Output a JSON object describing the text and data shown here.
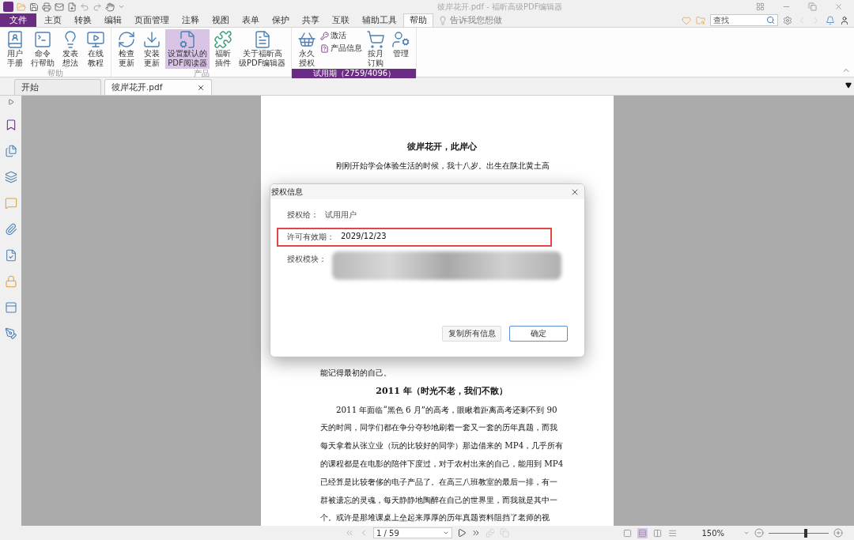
{
  "window": {
    "title": "彼岸花开.pdf - 福昕高级PDF编辑器"
  },
  "menu_tabs": [
    {
      "label": "文件",
      "kind": "file",
      "selected": false
    },
    {
      "label": "主页",
      "kind": "tab",
      "selected": false
    },
    {
      "label": "转换",
      "kind": "tab",
      "selected": false
    },
    {
      "label": "编辑",
      "kind": "tab",
      "selected": false
    },
    {
      "label": "页面管理",
      "kind": "tab",
      "selected": false
    },
    {
      "label": "注释",
      "kind": "tab",
      "selected": false
    },
    {
      "label": "视图",
      "kind": "tab",
      "selected": false
    },
    {
      "label": "表单",
      "kind": "tab",
      "selected": false
    },
    {
      "label": "保护",
      "kind": "tab",
      "selected": false
    },
    {
      "label": "共享",
      "kind": "tab",
      "selected": false
    },
    {
      "label": "互联",
      "kind": "tab",
      "selected": false
    },
    {
      "label": "辅助工具",
      "kind": "tab",
      "selected": false
    },
    {
      "label": "帮助",
      "kind": "tab",
      "selected": true
    }
  ],
  "tell_me": {
    "placeholder": "告诉我您想做"
  },
  "search": {
    "placeholder": "查找"
  },
  "ribbon_groups": [
    {
      "label": "帮助",
      "kind": "plain",
      "buttons": [
        {
          "kind": "large",
          "lines": [
            "用户",
            "手册"
          ],
          "highlighted": false
        },
        {
          "kind": "large",
          "lines": [
            "命令",
            "行帮助"
          ],
          "highlighted": false
        },
        {
          "kind": "large",
          "lines": [
            "发表",
            "想法"
          ],
          "highlighted": false
        },
        {
          "kind": "large",
          "lines": [
            "在线",
            "教程"
          ],
          "highlighted": false
        }
      ]
    },
    {
      "label": "产品",
      "kind": "plain",
      "buttons": [
        {
          "kind": "large",
          "lines": [
            "检查",
            "更新"
          ],
          "highlighted": false
        },
        {
          "kind": "large",
          "lines": [
            "安装",
            "更新"
          ],
          "highlighted": false
        },
        {
          "kind": "large",
          "lines": [
            "设置默认的",
            "PDF阅读器"
          ],
          "highlighted": true
        },
        {
          "kind": "large",
          "lines": [
            "福昕",
            "插件"
          ],
          "highlighted": false
        },
        {
          "kind": "large",
          "lines": [
            "关于福昕高",
            "级PDF编辑器"
          ],
          "highlighted": false
        }
      ]
    },
    {
      "label": "试用期（2759/4096）",
      "kind": "trial",
      "buttons": [
        {
          "kind": "large",
          "lines": [
            "永久",
            "授权"
          ],
          "highlighted": false
        },
        {
          "kind": "small",
          "items": [
            {
              "label": "激活"
            },
            {
              "label": "产品信息"
            }
          ]
        },
        {
          "kind": "large",
          "lines": [
            "按月",
            "订购"
          ],
          "highlighted": false
        },
        {
          "kind": "large",
          "lines": [
            "管理"
          ],
          "highlighted": false
        }
      ]
    }
  ],
  "doc_tabs": [
    {
      "label": "开始",
      "selected": false,
      "closable": false
    },
    {
      "label": "彼岸花开.pdf",
      "selected": true,
      "closable": true
    }
  ],
  "page": {
    "blocks": [
      {
        "kind": "heading",
        "text": "彼岸花开，此岸心"
      },
      {
        "kind": "paragraph",
        "lines": [
          "刚刚开始学会体验生活的时候，我十八岁。出生在陕北黄土高"
        ]
      },
      {
        "kind": "gap"
      },
      {
        "kind": "continuation",
        "lines": [
          "能记得最初的自己。"
        ]
      },
      {
        "kind": "heading",
        "text": "2011 年（时光不老，我们不散）"
      },
      {
        "kind": "paragraph",
        "lines": [
          "2011 年面临“黑色 6 月”的高考，眼瞅着距离高考还剩不到 90",
          "天的时间，同学们都在争分夺秒地刷着一套又一套的历年真题，而我",
          "每天拿着从张立业（玩的比较好的同学）那边借来的 MP4，几乎所有",
          "的课程都是在电影的陪伴下度过，对于农村出来的自己，能用到 MP4",
          "已经算是比较奢侈的电子产品了。在高三八班教室的最后一排，有一",
          "群被遗忘的灵魂，每天静静地陶醉在自己的世界里，而我就是其中一",
          "个。或许是那堆课桌上垒起来厚厚的历年真题资料阻挡了老师的视"
        ]
      }
    ]
  },
  "dialog": {
    "title": "授权信息",
    "rows": [
      {
        "kind": "text",
        "label": "授权给：",
        "value": "试用用户",
        "highlighted": false
      },
      {
        "kind": "text",
        "label": "许可有效期：",
        "value": "2029/12/23",
        "highlighted": true
      },
      {
        "kind": "redacted",
        "label": "授权模块：",
        "highlighted": false
      }
    ],
    "buttons": [
      {
        "label": "复制所有信息",
        "primary": false
      },
      {
        "label": "确定",
        "primary": true
      }
    ]
  },
  "status_bar": {
    "page_field": "1 / 59",
    "view_modes": [
      {
        "selected": false
      },
      {
        "selected": true
      },
      {
        "selected": false
      },
      {
        "selected": false
      }
    ],
    "zoom": "150%",
    "zoom_slider": {
      "level": 0.62
    }
  }
}
